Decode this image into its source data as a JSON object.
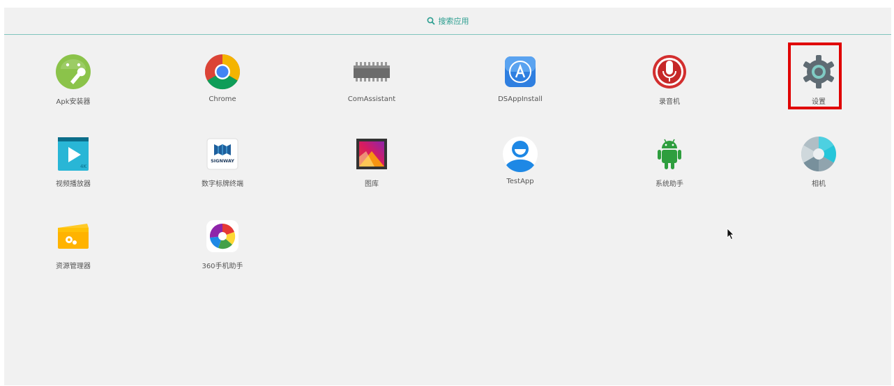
{
  "search": {
    "label": "搜索应用"
  },
  "apps": [
    {
      "label": "Apk安装器",
      "icon": "android-wrench-icon"
    },
    {
      "label": "Chrome",
      "icon": "chrome-icon"
    },
    {
      "label": "ComAssistant",
      "icon": "chip-icon"
    },
    {
      "label": "DSAppInstall",
      "icon": "app-store-icon"
    },
    {
      "label": "录音机",
      "icon": "microphone-icon"
    },
    {
      "label": "设置",
      "icon": "gear-icon"
    },
    {
      "label": "视频播放器",
      "icon": "video-player-icon"
    },
    {
      "label": "数字标牌终端",
      "icon": "signway-icon"
    },
    {
      "label": "图库",
      "icon": "gallery-icon"
    },
    {
      "label": "TestApp",
      "icon": "avatar-icon"
    },
    {
      "label": "系统助手",
      "icon": "android-icon"
    },
    {
      "label": "相机",
      "icon": "camera-shutter-icon"
    },
    {
      "label": "资源管理器",
      "icon": "folder-gear-icon"
    },
    {
      "label": "360手机助手",
      "icon": "360-assistant-icon"
    }
  ],
  "colors": {
    "accent": "#2a9d8f",
    "highlight": "#e00000",
    "background": "#f1f1f1"
  }
}
